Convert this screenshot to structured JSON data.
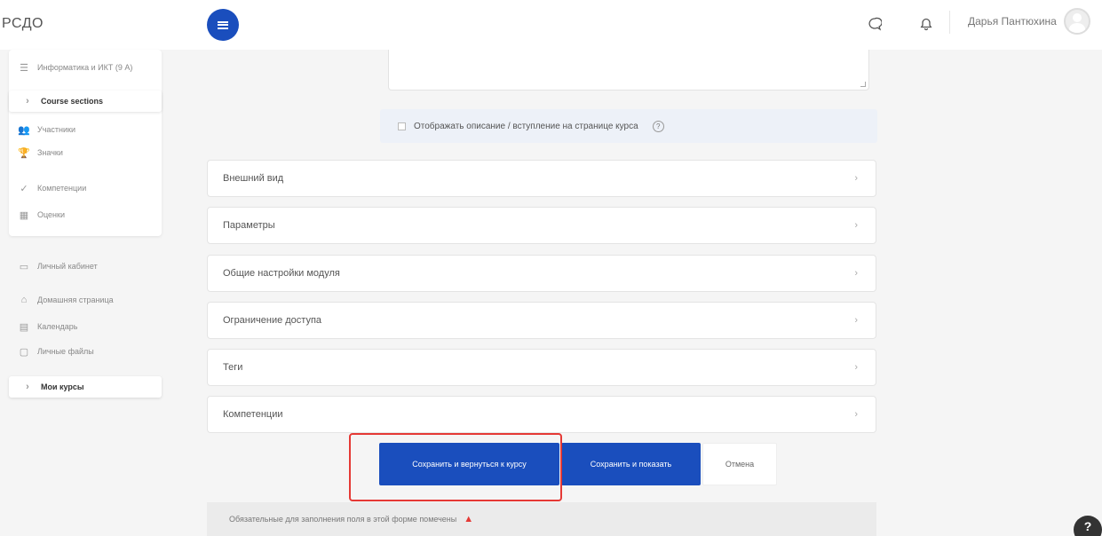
{
  "header": {
    "brand": "РСДО",
    "username": "Дарья Пантюхина"
  },
  "sidebar": {
    "course_items": [
      {
        "label": "Информатика и ИКТ (9 А)",
        "icon": "course-icon"
      },
      {
        "label": "Course sections",
        "icon": "chevron-icon"
      },
      {
        "label": "Участники",
        "icon": "users-icon"
      },
      {
        "label": "Значки",
        "icon": "trophy-icon"
      },
      {
        "label": "Компетенции",
        "icon": "check-icon"
      },
      {
        "label": "Оценки",
        "icon": "grades-icon"
      }
    ],
    "general_items": [
      {
        "label": "Личный кабинет",
        "icon": "dashboard-icon"
      },
      {
        "label": "Домашняя страница",
        "icon": "home-icon"
      },
      {
        "label": "Календарь",
        "icon": "calendar-icon"
      },
      {
        "label": "Личные файлы",
        "icon": "files-icon"
      },
      {
        "label": "Мои курсы",
        "icon": "chevron-icon"
      }
    ]
  },
  "form": {
    "show_description_label": "Отображать описание / вступление на странице курса",
    "help_symbol": "?",
    "sections": [
      "Внешний вид",
      "Параметры",
      "Общие настройки модуля",
      "Ограничение доступа",
      "Теги",
      "Компетенции"
    ],
    "buttons": {
      "save_return": "Сохранить и вернуться к курсу",
      "save_show": "Сохранить и показать",
      "cancel": "Отмена"
    },
    "required_note": "Обязательные для заполнения поля в этой форме помечены"
  },
  "colors": {
    "primary": "#1a4ebd",
    "highlight": "#e53935"
  }
}
